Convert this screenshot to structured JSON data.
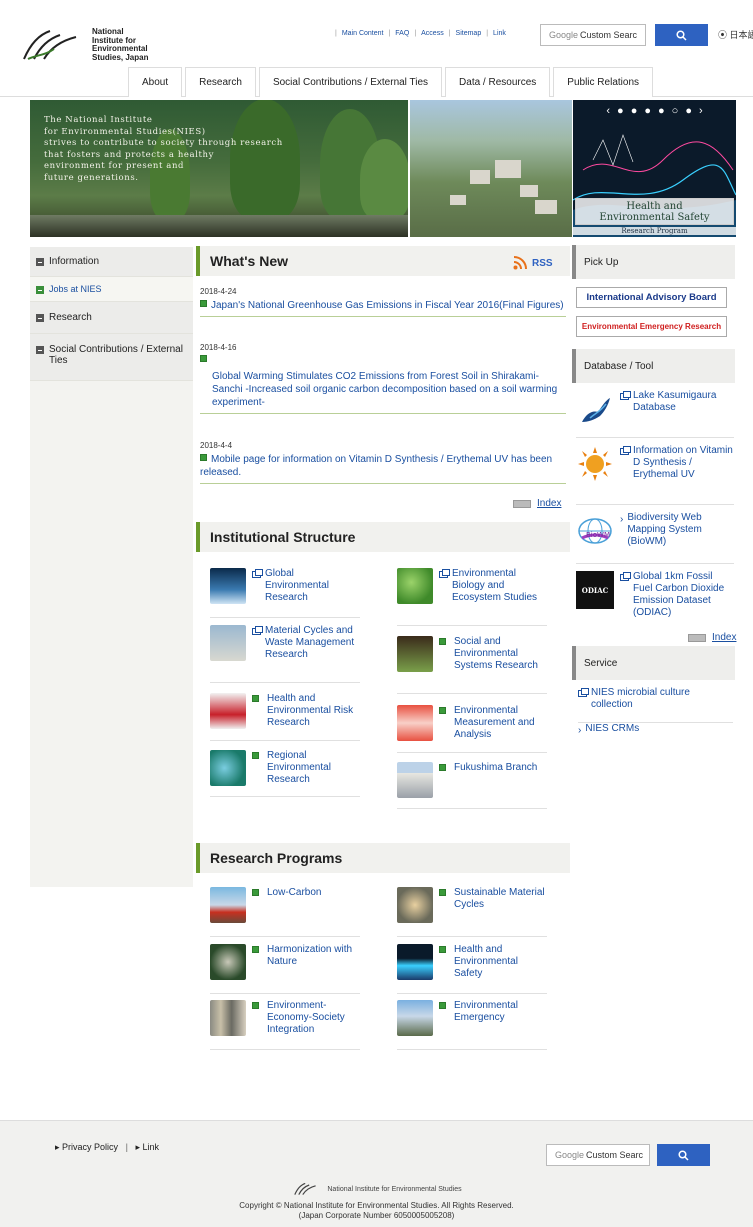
{
  "header": {
    "logo_lines": [
      "National",
      "Institute for",
      "Environmental",
      "Studies, Japan"
    ],
    "util_links": [
      "Main Content",
      "FAQ",
      "Access",
      "Sitemap",
      "Link"
    ],
    "search_placeholder_brand": "Google",
    "search_placeholder": "Custom Searc",
    "search_icon": "search-icon",
    "language_link": "日本語",
    "nav": [
      "About",
      "Research",
      "Social Contributions / External Ties",
      "Data / Resources",
      "Public Relations"
    ]
  },
  "hero": {
    "lines": [
      "The National Institute",
      "for Environmental Studies(NIES)",
      "strives to contribute to society through research",
      "that fosters and protects a healthy",
      "environment for present and",
      "future generations."
    ],
    "caption_line1": "Health and",
    "caption_line2": "Environmental Safety",
    "caption_sub": "Research Program"
  },
  "sidebar": {
    "items": [
      {
        "label": "Information"
      },
      {
        "label": "Jobs at NIES"
      },
      {
        "label": "Research"
      },
      {
        "label": "Social Contributions / External Ties"
      }
    ]
  },
  "whats_new": {
    "title": "What's New",
    "rss": "RSS",
    "items": [
      {
        "date": "2018-4-24",
        "text": "Japan's National Greenhouse Gas Emissions in Fiscal Year 2016(Final Figures)"
      },
      {
        "date": "2018-4-16",
        "text": "Global Warming Stimulates CO2 Emissions from Forest Soil in Shirakami-Sanchi -Increased soil organic carbon decomposition based on a soil warming experiment-"
      },
      {
        "date": "2018-4-4",
        "text": "Mobile page for information on Vitamin D Synthesis / Erythemal UV has been released."
      }
    ],
    "index": "Index"
  },
  "institutional": {
    "title": "Institutional Structure",
    "items": [
      {
        "label": "Global Environmental Research",
        "icon": "external-link-icon"
      },
      {
        "label": "Environmental Biology and Ecosystem Studies",
        "icon": "external-link-icon"
      },
      {
        "label": "Material Cycles and Waste Management Research",
        "icon": "external-link-icon"
      },
      {
        "label": "Social and Environmental Systems Research",
        "icon": "green-square-icon"
      },
      {
        "label": "Health and Environmental Risk Research",
        "icon": "green-square-icon"
      },
      {
        "label": "Environmental Measurement and Analysis",
        "icon": "green-square-icon"
      },
      {
        "label": "Regional Environmental Research",
        "icon": "green-square-icon"
      },
      {
        "label": "Fukushima Branch",
        "icon": "green-square-icon"
      }
    ]
  },
  "programs": {
    "title": "Research Programs",
    "items": [
      {
        "label": "Low-Carbon"
      },
      {
        "label": "Sustainable Material Cycles"
      },
      {
        "label": "Harmonization with Nature"
      },
      {
        "label": "Health and Environmental Safety"
      },
      {
        "label": "Environment-Economy-Society Integration"
      },
      {
        "label": "Environmental Emergency"
      }
    ]
  },
  "right": {
    "pickup_title": "Pick Up",
    "banner1": "International Advisory Board",
    "banner2": "Environmental Emergency Research",
    "db_title": "Database / Tool",
    "db_items": [
      {
        "label": "Lake Kasumigaura Database"
      },
      {
        "label": "Information on Vitamin D Synthesis / Erythemal UV"
      },
      {
        "label": "Biodiversity Web Mapping System (BioWM)"
      },
      {
        "label": "Global 1km Fossil Fuel Carbon Dioxide Emission Dataset (ODIAC)"
      }
    ],
    "odiac_logo": "ODIAC",
    "biowm_logo": "BioWM",
    "index": "Index",
    "service_title": "Service",
    "service_items": [
      {
        "label": "NIES microbial culture collection"
      },
      {
        "label": "NIES CRMs"
      }
    ]
  },
  "footer": {
    "links": [
      "Privacy Policy",
      "Link"
    ],
    "search_placeholder_brand": "Google",
    "search_placeholder": "Custom Searc",
    "logo_text": "National Institute for Environmental Studies",
    "copyright": "Copyright © National Institute for Environmental Studies. All Rights Reserved.",
    "corp_number": "(Japan Corporate Number 6050005005208)"
  },
  "colors": {
    "accent_green": "#6a9a2a",
    "link_blue": "#1a4fa0",
    "button_blue": "#2e62c1",
    "banner_red": "#d02020"
  }
}
